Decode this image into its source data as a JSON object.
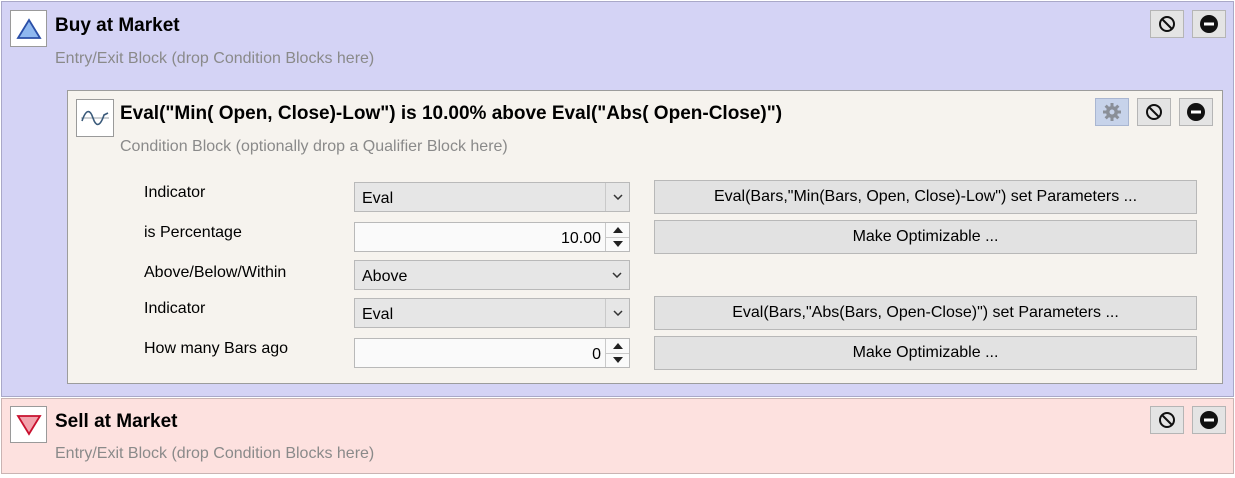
{
  "buy_block": {
    "title": "Buy at Market",
    "subtitle": "Entry/Exit Block (drop Condition Blocks here)",
    "icon": "triangle-up-icon",
    "background": "#d4d3f5"
  },
  "condition_block": {
    "title": "Eval(\"Min( Open, Close)-Low\") is 10.00% above Eval(\"Abs( Open-Close)\")",
    "subtitle": "Condition Block (optionally drop a Qualifier Block here)",
    "icon": "wave-chart-icon",
    "background": "#f6f3ee",
    "rows": [
      {
        "label": "Indicator",
        "control": "select",
        "value": "Eval",
        "button": "Eval(Bars,\"Min(Bars, Open, Close)-Low\") set Parameters ..."
      },
      {
        "label": "is Percentage",
        "control": "number",
        "value": "10.00",
        "button": "Make Optimizable ..."
      },
      {
        "label": "Above/Below/Within",
        "control": "select",
        "value": "Above"
      },
      {
        "label": "Indicator",
        "control": "select",
        "value": "Eval",
        "button": "Eval(Bars,\"Abs(Bars, Open-Close)\") set Parameters ..."
      },
      {
        "label": "How many Bars ago",
        "control": "number",
        "value": "0",
        "button": "Make Optimizable ..."
      }
    ]
  },
  "sell_block": {
    "title": "Sell at Market",
    "subtitle": "Entry/Exit Block (drop Condition Blocks here)",
    "icon": "triangle-down-icon",
    "background": "#fde1df"
  },
  "toolbar_icons": {
    "settings": "gear-icon",
    "disable": "disable-icon",
    "remove": "remove-icon"
  }
}
